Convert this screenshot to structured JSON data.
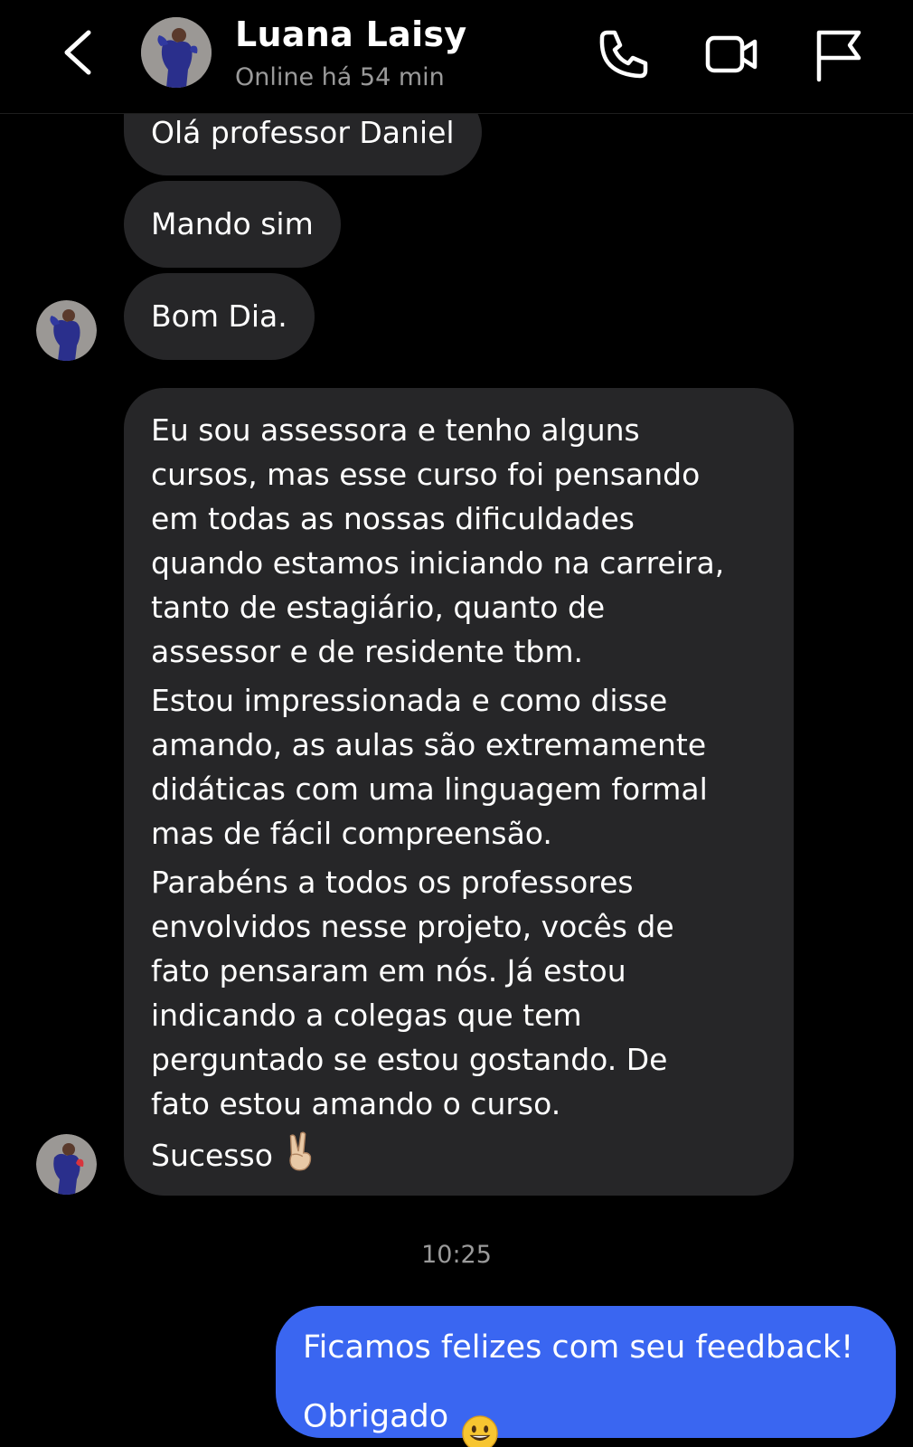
{
  "header": {
    "contact_name": "Luana Laisy",
    "status": "Online há 54 min",
    "icons": [
      "back-chevron-icon",
      "phone-icon",
      "video-camera-icon",
      "flag-icon"
    ]
  },
  "messages": {
    "received": [
      {
        "text": "Olá professor Daniel"
      },
      {
        "text": "Mando sim"
      },
      {
        "text": "Bom Dia."
      }
    ],
    "long_message": {
      "paragraphs": [
        "Eu sou assessora e tenho alguns\ncursos, mas esse curso foi pensando\nem todas as nossas dificuldades\nquando estamos iniciando na carreira,\ntanto de estagiário, quanto de\nassessor e de residente tbm.",
        "Estou impressionada e como disse\namando, as aulas são extremamente\ndidáticas com uma linguagem formal\nmas de fácil compreensão.",
        "Parabéns a todos os professores\nenvolvidos nesse projeto, vocês de\nfato pensaram em nós. Já estou\nindicando a colegas que tem\nperguntado se estou gostando. De\nfato estou amando o curso."
      ],
      "closing": "Sucesso",
      "closing_emoji": "victory-hand-emoji"
    },
    "timestamp": "10:25",
    "sent": {
      "text": "Ficamos felizes com seu feedback!\nObrigado",
      "emoji": "smiley-emoji"
    }
  },
  "colors": {
    "background": "#000000",
    "received_bubble": "#262628",
    "sent_bubble": "#3a66f1",
    "secondary_text": "#9a9a9a"
  }
}
